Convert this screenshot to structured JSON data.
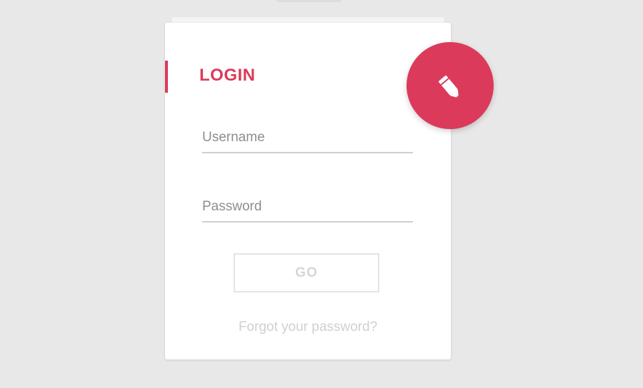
{
  "login": {
    "title": "LOGIN",
    "username_placeholder": "Username",
    "password_placeholder": "Password",
    "go_label": "GO",
    "forgot_label": "Forgot your password?"
  },
  "fab": {
    "icon": "pencil-icon"
  },
  "colors": {
    "accent": "#dc3a5b",
    "background": "#e8e8e8",
    "card": "#ffffff"
  }
}
